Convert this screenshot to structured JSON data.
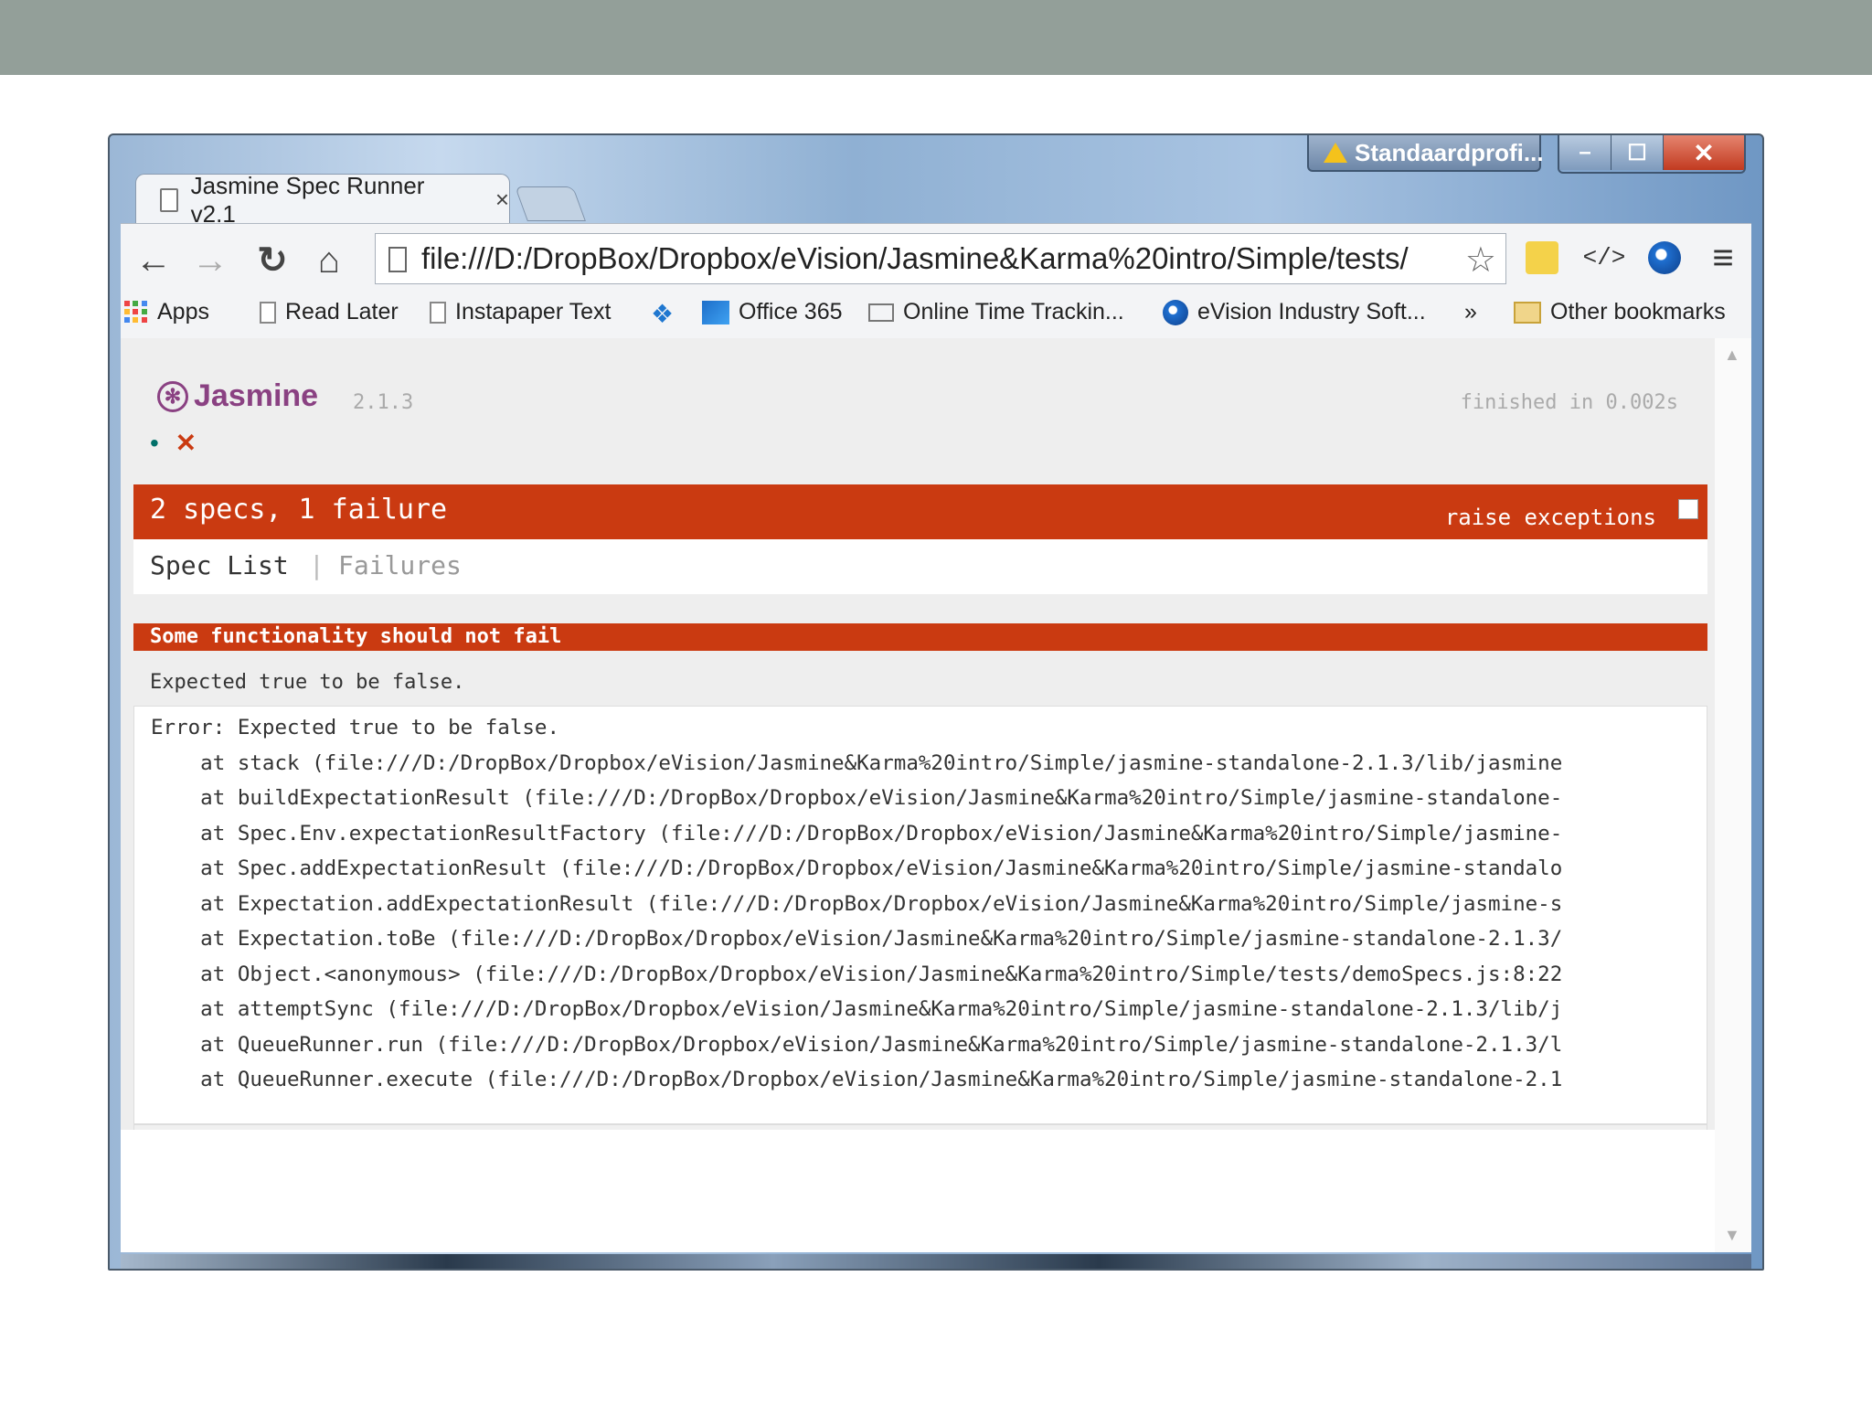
{
  "window": {
    "profile_label": "Standaardprofi...",
    "min_label": "–",
    "max_label": "☐",
    "close_label": "✕"
  },
  "tab": {
    "title": "Jasmine Spec Runner v2.1",
    "close": "×"
  },
  "toolbar": {
    "back": "←",
    "forward": "→",
    "reload": "↻",
    "home": "⌂",
    "url": "file:///D:/DropBox/Dropbox/eVision/Jasmine&Karma%20intro/Simple/tests/",
    "ext_code": "</>",
    "menu": "≡"
  },
  "bookmarks": {
    "apps": "Apps",
    "read_later": "Read Later",
    "instapaper": "Instapaper Text",
    "office": "Office 365",
    "time_tracking": "Online Time Trackin...",
    "evision": "eVision Industry Soft...",
    "more": "»",
    "other": "Other bookmarks"
  },
  "jasmine": {
    "logo": "Jasmine",
    "version": "2.1.3",
    "finished": "finished in 0.002s",
    "dot_pass": "•",
    "dot_fail": "✕",
    "summary": "2 specs, 1 failure",
    "raise_exceptions": "raise exceptions",
    "menu_spec_list": "Spec List",
    "menu_sep": "|",
    "menu_failures": "Failures",
    "failed_spec": "Some functionality should not fail",
    "failure_message": "Expected true to be false.",
    "stack": [
      "Error: Expected true to be false.",
      "    at stack (file:///D:/DropBox/Dropbox/eVision/Jasmine&Karma%20intro/Simple/jasmine-standalone-2.1.3/lib/jasmine",
      "    at buildExpectationResult (file:///D:/DropBox/Dropbox/eVision/Jasmine&Karma%20intro/Simple/jasmine-standalone-",
      "    at Spec.Env.expectationResultFactory (file:///D:/DropBox/Dropbox/eVision/Jasmine&Karma%20intro/Simple/jasmine-",
      "    at Spec.addExpectationResult (file:///D:/DropBox/Dropbox/eVision/Jasmine&Karma%20intro/Simple/jasmine-standalo",
      "    at Expectation.addExpectationResult (file:///D:/DropBox/Dropbox/eVision/Jasmine&Karma%20intro/Simple/jasmine-s",
      "    at Expectation.toBe (file:///D:/DropBox/Dropbox/eVision/Jasmine&Karma%20intro/Simple/jasmine-standalone-2.1.3/",
      "    at Object.<anonymous> (file:///D:/DropBox/Dropbox/eVision/Jasmine&Karma%20intro/Simple/tests/demoSpecs.js:8:22",
      "    at attemptSync (file:///D:/DropBox/Dropbox/eVision/Jasmine&Karma%20intro/Simple/jasmine-standalone-2.1.3/lib/j",
      "    at QueueRunner.run (file:///D:/DropBox/Dropbox/eVision/Jasmine&Karma%20intro/Simple/jasmine-standalone-2.1.3/l",
      "    at QueueRunner.execute (file:///D:/DropBox/Dropbox/eVision/Jasmine&Karma%20intro/Simple/jasmine-standalone-2.1"
    ]
  },
  "colors": {
    "failure_red": "#ca3a11",
    "jasmine_purple": "#8a4182",
    "pass_green": "#007069",
    "slide_band": "#939f99"
  }
}
